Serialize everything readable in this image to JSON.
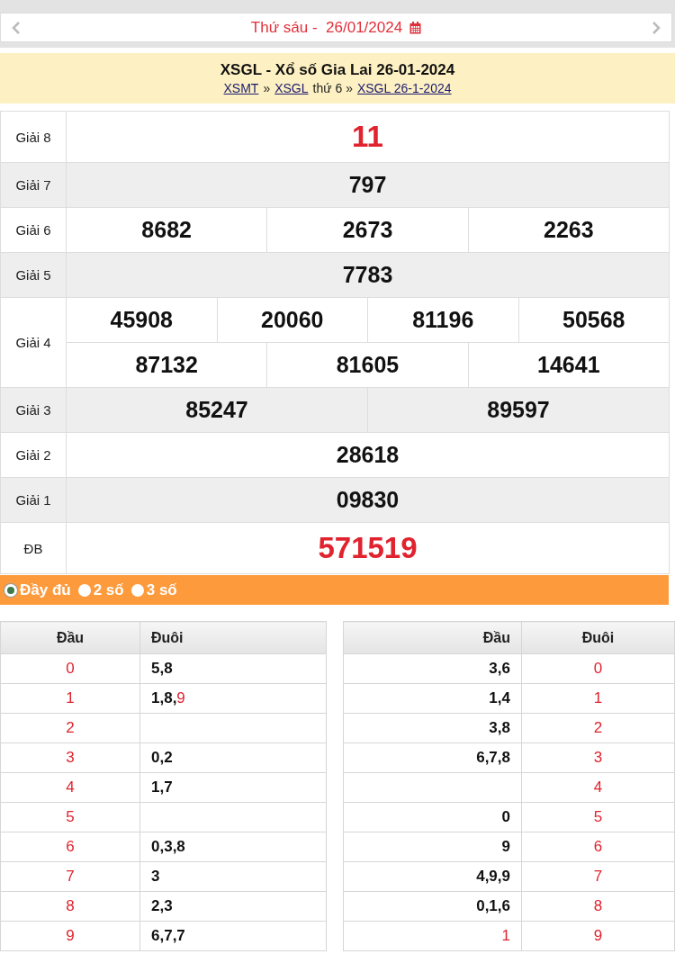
{
  "date_nav": {
    "label": "Thứ sáu -  26/01/2024"
  },
  "header": {
    "title": "XSGL - Xổ số Gia Lai 26-01-2024",
    "breadcrumb": [
      {
        "kind": "link",
        "text": "XSMT"
      },
      {
        "kind": "text",
        "text": "»"
      },
      {
        "kind": "link",
        "text": "XSGL"
      },
      {
        "kind": "text",
        "text": "thứ 6 »"
      },
      {
        "kind": "link",
        "text": "XSGL 26-1-2024"
      }
    ]
  },
  "results": [
    {
      "label": "Giải 8",
      "kind": "top",
      "lines": [
        [
          "11"
        ]
      ]
    },
    {
      "label": "Giải 7",
      "kind": "normal",
      "lines": [
        [
          "797"
        ]
      ]
    },
    {
      "label": "Giải 6",
      "kind": "normal",
      "lines": [
        [
          "8682",
          "2673",
          "2263"
        ]
      ]
    },
    {
      "label": "Giải 5",
      "kind": "normal",
      "lines": [
        [
          "7783"
        ]
      ]
    },
    {
      "label": "Giải 4",
      "kind": "normal",
      "lines": [
        [
          "45908",
          "20060",
          "81196",
          "50568"
        ],
        [
          "87132",
          "81605",
          "14641"
        ]
      ]
    },
    {
      "label": "Giải 3",
      "kind": "normal",
      "lines": [
        [
          "85247",
          "89597"
        ]
      ]
    },
    {
      "label": "Giải 2",
      "kind": "normal",
      "lines": [
        [
          "28618"
        ]
      ]
    },
    {
      "label": "Giải 1",
      "kind": "normal",
      "lines": [
        [
          "09830"
        ]
      ]
    },
    {
      "label": "ĐB",
      "kind": "top",
      "lines": [
        [
          "571519"
        ]
      ]
    }
  ],
  "display_options": [
    {
      "label": "Đầy đủ",
      "selected": true
    },
    {
      "label": "2 số",
      "selected": false
    },
    {
      "label": "3 số",
      "selected": false
    }
  ],
  "loto_left": {
    "columns": [
      "Đầu",
      "Đuôi"
    ],
    "rows": [
      {
        "head": "0",
        "tail": [
          {
            "text": "5,8",
            "special": false
          }
        ]
      },
      {
        "head": "1",
        "tail": [
          {
            "text": "1,8,",
            "special": false
          },
          {
            "text": "9",
            "special": true
          }
        ]
      },
      {
        "head": "2",
        "tail": []
      },
      {
        "head": "3",
        "tail": [
          {
            "text": "0,2",
            "special": false
          }
        ]
      },
      {
        "head": "4",
        "tail": [
          {
            "text": "1,7",
            "special": false
          }
        ]
      },
      {
        "head": "5",
        "tail": []
      },
      {
        "head": "6",
        "tail": [
          {
            "text": "0,3,8",
            "special": false
          }
        ]
      },
      {
        "head": "7",
        "tail": [
          {
            "text": "3",
            "special": false
          }
        ]
      },
      {
        "head": "8",
        "tail": [
          {
            "text": "2,3",
            "special": false
          }
        ]
      },
      {
        "head": "9",
        "tail": [
          {
            "text": "6,7,7",
            "special": false
          }
        ]
      }
    ]
  },
  "loto_right": {
    "columns": [
      "Đầu",
      "Đuôi"
    ],
    "rows": [
      {
        "head": [
          {
            "text": "3,6",
            "special": false
          }
        ],
        "tail": "0"
      },
      {
        "head": [
          {
            "text": "1,4",
            "special": false
          }
        ],
        "tail": "1"
      },
      {
        "head": [
          {
            "text": "3,8",
            "special": false
          }
        ],
        "tail": "2"
      },
      {
        "head": [
          {
            "text": "6,7,8",
            "special": false
          }
        ],
        "tail": "3"
      },
      {
        "head": [],
        "tail": "4"
      },
      {
        "head": [
          {
            "text": "0",
            "special": false
          }
        ],
        "tail": "5"
      },
      {
        "head": [
          {
            "text": "9",
            "special": false
          }
        ],
        "tail": "6"
      },
      {
        "head": [
          {
            "text": "4,9,9",
            "special": false
          }
        ],
        "tail": "7"
      },
      {
        "head": [
          {
            "text": "0,1,6",
            "special": false
          }
        ],
        "tail": "8"
      },
      {
        "head": [
          {
            "text": "1",
            "special": true
          }
        ],
        "tail": "9"
      }
    ]
  }
}
